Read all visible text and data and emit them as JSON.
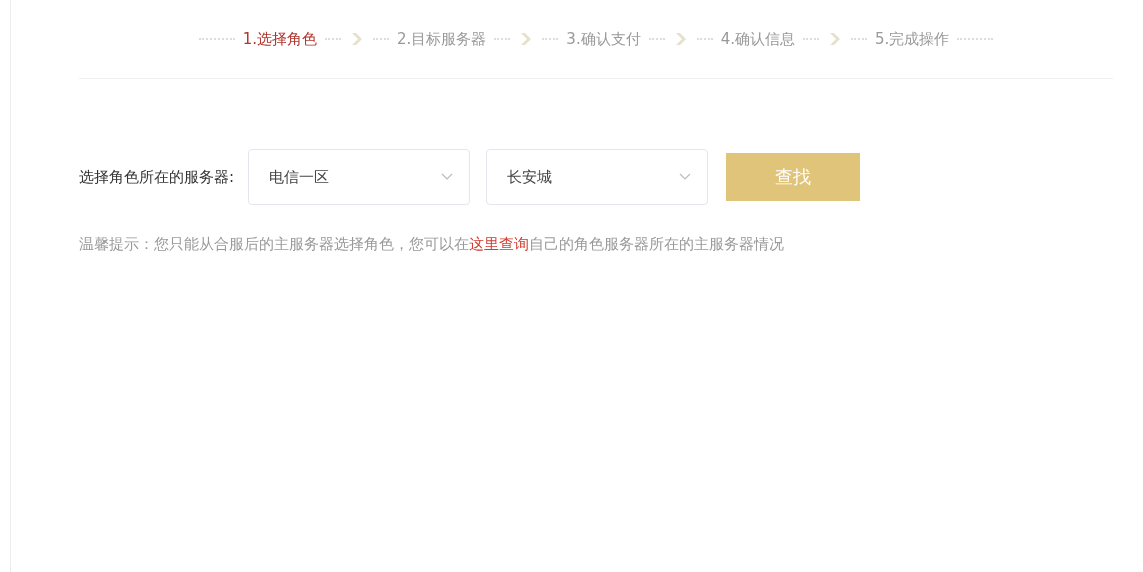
{
  "steps": [
    {
      "label": "1.选择角色",
      "selected": true
    },
    {
      "label": "2.目标服务器",
      "selected": false
    },
    {
      "label": "3.确认支付",
      "selected": false
    },
    {
      "label": "4.确认信息",
      "selected": false
    },
    {
      "label": "5.完成操作",
      "selected": false
    }
  ],
  "form": {
    "label": "选择角色所在的服务器:",
    "selects": [
      {
        "value": "电信一区"
      },
      {
        "value": "长安城"
      }
    ],
    "button": "查找"
  },
  "tip": {
    "before": "温馨提示：您只能从合服后的主服务器选择角色，您可以在",
    "link": "这里查询",
    "after": "自己的角色服务器所在的主服务器情况"
  }
}
